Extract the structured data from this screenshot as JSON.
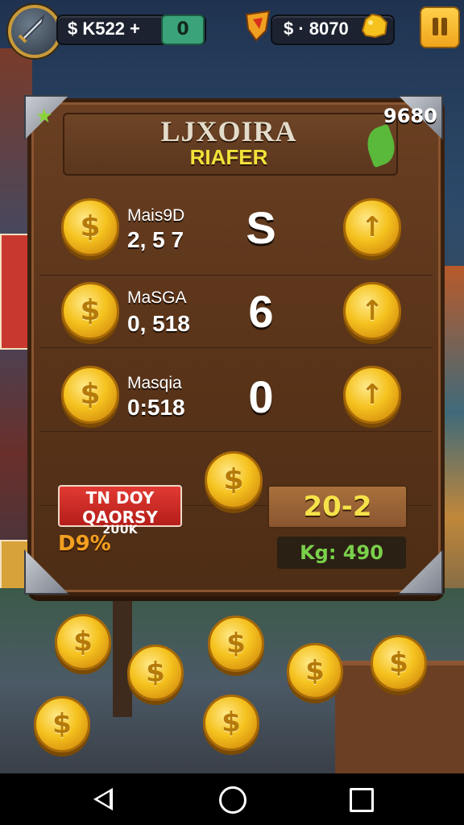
{
  "hud": {
    "balance": "$ K522 +",
    "green_value": "0",
    "currency": "$ · 8070"
  },
  "board": {
    "title": "LJXOIRA",
    "subtitle": "RIAFER",
    "corner_number": "9680",
    "rows": [
      {
        "label": "Mais9D",
        "value": "2, 5 7",
        "big": "S"
      },
      {
        "label": "MaSGA",
        "value": "0, 518",
        "big": "6"
      },
      {
        "label": "Masqia",
        "value": "0:518",
        "big": "0"
      }
    ],
    "red_banner_line1": "TN DOY QAORSY",
    "red_banner_line2": "2UUK",
    "score": "20-2",
    "percent": "D9%",
    "kg": "Kg: 490"
  },
  "icons": {
    "coin_symbol": "$",
    "coin_button_symbol": "↑"
  },
  "colors": {
    "gold": "#f5c21e",
    "board": "#5a3419",
    "accent_yellow": "#f2e23a",
    "green": "#7ad04a",
    "red": "#d02a24"
  }
}
